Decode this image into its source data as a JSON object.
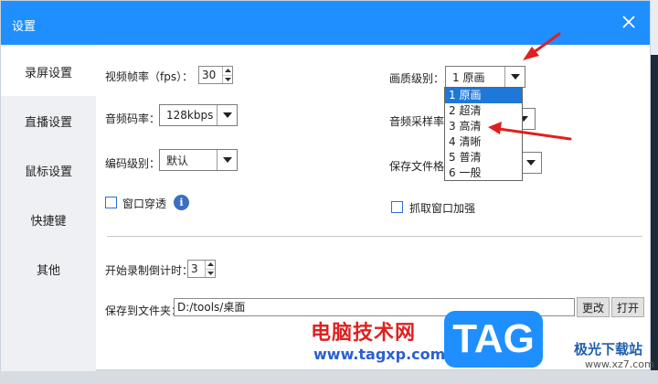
{
  "window": {
    "title": "设置"
  },
  "sidebar": {
    "items": [
      {
        "label": "录屏设置",
        "active": true
      },
      {
        "label": "直播设置",
        "active": false
      },
      {
        "label": "鼠标设置",
        "active": false
      },
      {
        "label": "快捷键",
        "active": false
      },
      {
        "label": "其他",
        "active": false
      }
    ]
  },
  "video": {
    "fps_label": "视频帧率（fps）：",
    "fps_value": "30",
    "quality_label": "画质级别：",
    "quality_value": "1 原画",
    "audio_bitrate_label": "音频码率：",
    "audio_bitrate_value": "128kbps",
    "sample_rate_label": "音频采样率",
    "encode_label": "编码级别：",
    "encode_value": "默认",
    "save_format_label": "保存文件格",
    "window_through_label": "窗口穿透",
    "capture_boost_label": "抓取窗口加强"
  },
  "quality_options": [
    "1 原画",
    "2 超清",
    "3 高清",
    "4 清晰",
    "5 普清",
    "6 一般"
  ],
  "countdown": {
    "label": "开始录制倒计时：",
    "value": "3"
  },
  "save_folder": {
    "label": "保存到文件夹：",
    "value": "D:/tools/桌面",
    "change_btn": "更改",
    "open_btn": "打开"
  },
  "watermark": {
    "site_name": "电脑技术网",
    "site_url": "www.tagxp.com",
    "logo": "TAG",
    "brand": "极光下载站",
    "brand_url": "www.xz7.com"
  },
  "colors": {
    "titlebar": "#1f8fff",
    "selected": "#1e78d7",
    "annotation": "#e02020"
  }
}
